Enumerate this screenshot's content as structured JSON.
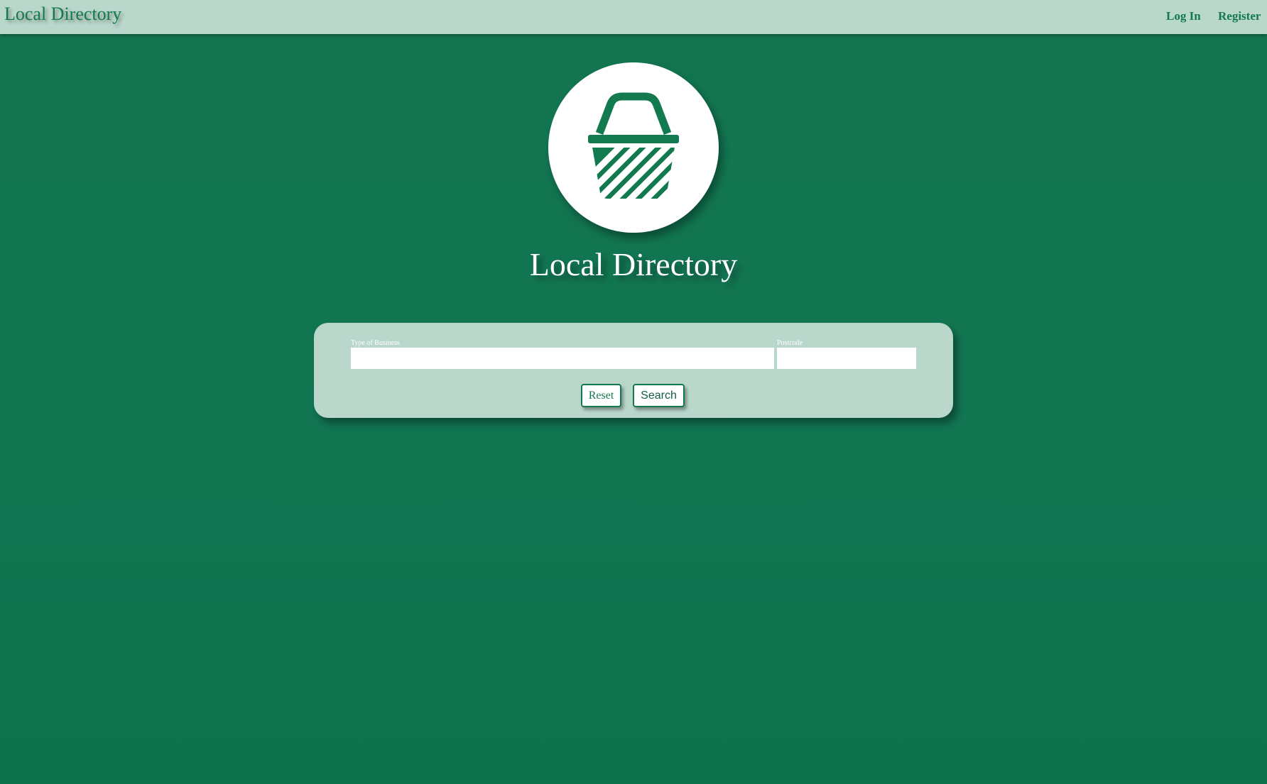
{
  "header": {
    "brand": "Local Directory",
    "nav": {
      "login": "Log In",
      "register": "Register"
    }
  },
  "hero": {
    "logo_icon": "shopping-basket-icon",
    "title": "Local Directory"
  },
  "search": {
    "type_label": "Type of Business",
    "type_value": "",
    "postcode_label": "Postcode",
    "postcode_value": "",
    "reset_label": "Reset",
    "search_label": "Search"
  },
  "colors": {
    "brand_green": "#13794f",
    "background_green": "#117552",
    "panel_mint": "#bad7cc",
    "white": "#ffffff"
  }
}
